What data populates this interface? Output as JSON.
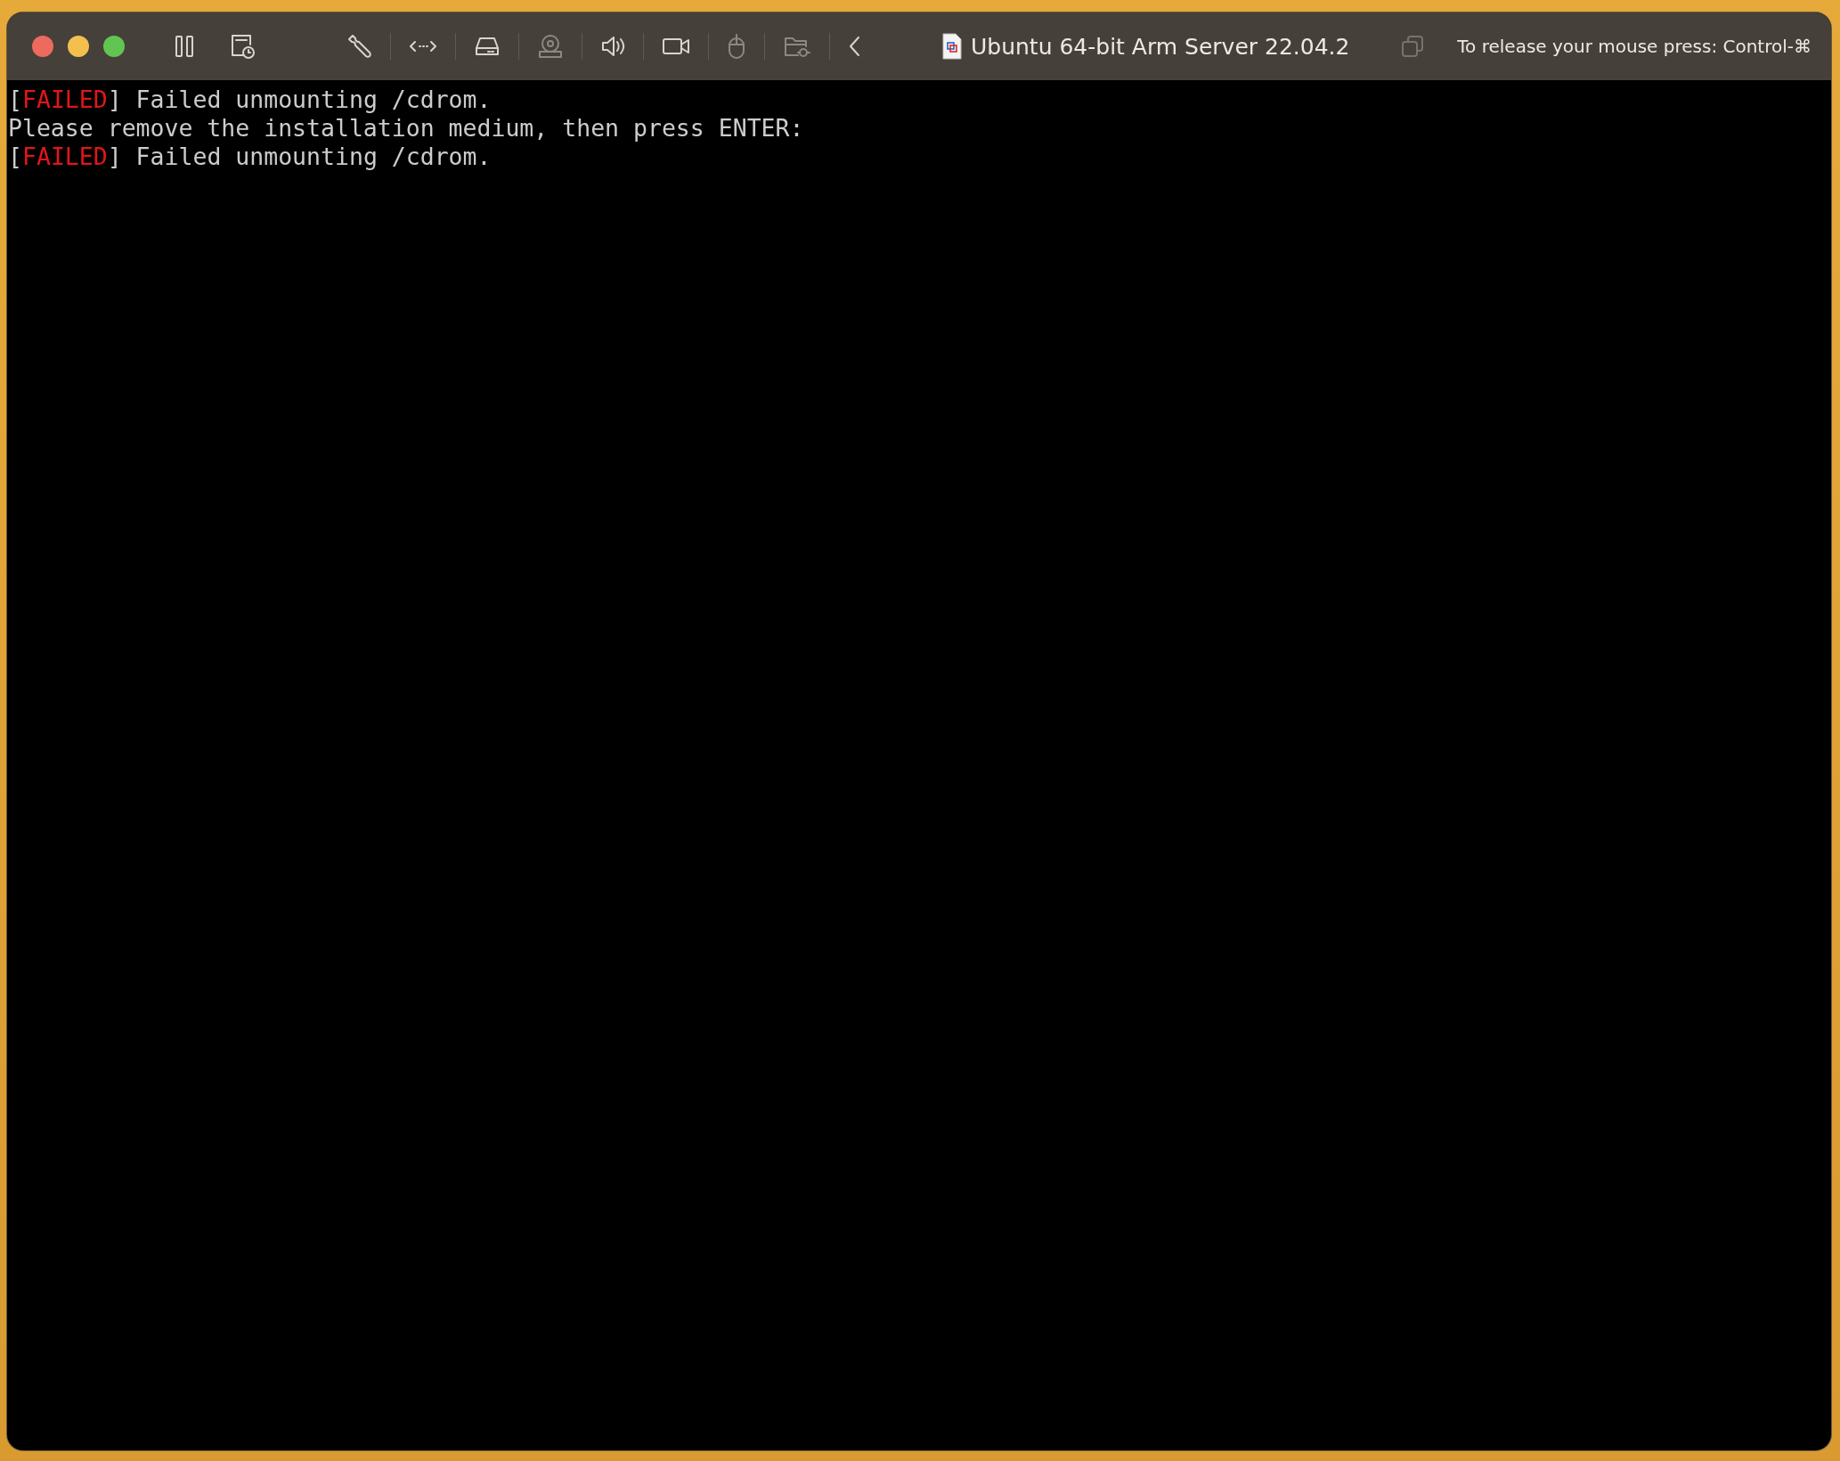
{
  "window": {
    "title": "Ubuntu 64-bit Arm Server 22.04.2",
    "hint": "To release your mouse press: Control-⌘"
  },
  "traffic_lights": [
    {
      "kind": "close"
    },
    {
      "kind": "minimize"
    },
    {
      "kind": "zoom"
    }
  ],
  "toolbar": [
    {
      "kind": "pause",
      "disabled": false
    },
    {
      "kind": "snapshot",
      "disabled": false
    },
    {
      "kind": "wrench",
      "disabled": false
    },
    {
      "kind": "network",
      "disabled": false
    },
    {
      "kind": "drive",
      "disabled": false
    },
    {
      "kind": "disc",
      "disabled": true
    },
    {
      "kind": "speaker",
      "disabled": false
    },
    {
      "kind": "camera",
      "disabled": false
    },
    {
      "kind": "mouse",
      "disabled": true
    },
    {
      "kind": "folder",
      "disabled": true
    },
    {
      "kind": "back",
      "disabled": false
    }
  ],
  "terminal": {
    "lines": [
      {
        "segments": [
          {
            "text": "[",
            "color": "#cccccc"
          },
          {
            "text": "FAILED",
            "color": "#e0161a"
          },
          {
            "text": "] Failed unmounting /cdrom.",
            "color": "#cccccc"
          }
        ]
      },
      {
        "segments": [
          {
            "text": "Please remove the installation medium, then press ENTER:",
            "color": "#cccccc"
          }
        ]
      },
      {
        "segments": [
          {
            "text": "[",
            "color": "#cccccc"
          },
          {
            "text": "FAILED",
            "color": "#e0161a"
          },
          {
            "text": "] Failed unmounting /cdrom.",
            "color": "#cccccc"
          }
        ]
      }
    ]
  }
}
